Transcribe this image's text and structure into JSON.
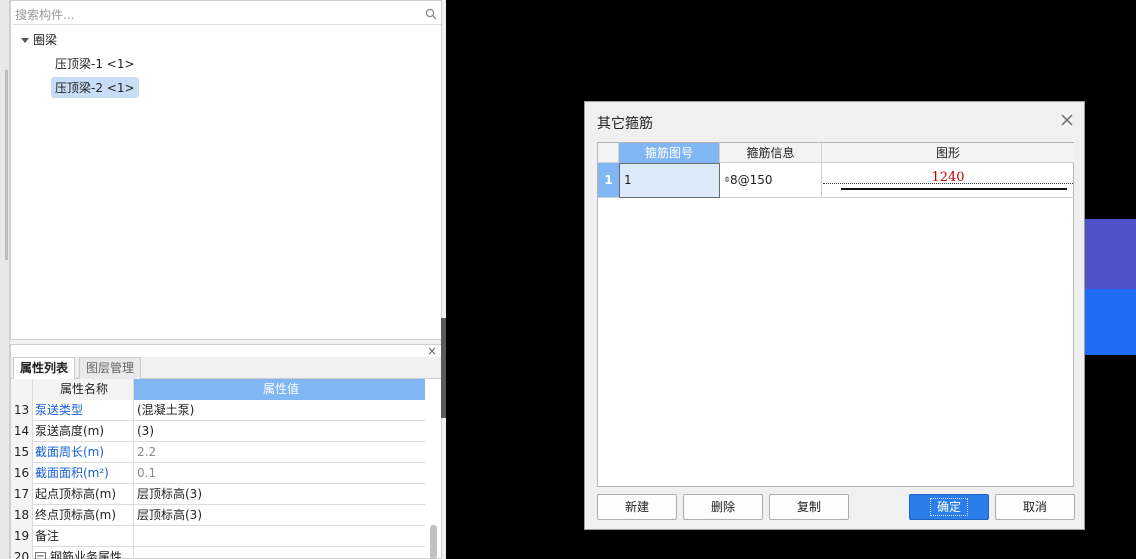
{
  "left_panel": {
    "search": {
      "placeholder": "搜索构件..."
    },
    "tree": {
      "root": "圈梁",
      "children": [
        "压顶梁-1 <1>",
        "压顶梁-2 <1>"
      ],
      "selected_index": 1
    }
  },
  "properties": {
    "close_glyph": "×",
    "tabs": [
      "属性列表",
      "图层管理"
    ],
    "header": {
      "name": "属性名称",
      "value": "属性值"
    },
    "rows": [
      {
        "num": "13",
        "name": "泵送类型",
        "value": "(混凝土泵)"
      },
      {
        "num": "14",
        "name": "泵送高度(m)",
        "value": "(3)"
      },
      {
        "num": "15",
        "name": "截面周长(m)",
        "value": "2.2"
      },
      {
        "num": "16",
        "name": "截面面积(m²)",
        "value": "0.1"
      },
      {
        "num": "17",
        "name": "起点顶标高(m)",
        "value": "层顶标高(3)"
      },
      {
        "num": "18",
        "name": "终点顶标高(m)",
        "value": "层顶标高(3)"
      },
      {
        "num": "19",
        "name": "备注",
        "value": ""
      },
      {
        "num": "20",
        "name": "钢筋业务属性",
        "value": ""
      }
    ]
  },
  "dialog": {
    "title": "其它箍筋",
    "grid": {
      "headers": [
        "箍筋图号",
        "箍筋信息",
        "图形"
      ],
      "rows": [
        {
          "row_num": "1",
          "shape_no": "1",
          "rebar_glyph": "⌽",
          "rebar_info": "8@150",
          "shape_value": "1240"
        }
      ]
    },
    "buttons": {
      "new": "新建",
      "delete": "删除",
      "copy": "复制",
      "ok": "确定",
      "cancel": "取消"
    }
  },
  "colors": {
    "accent_blue": "#7fb6f3",
    "ok_button": "#2b7de9",
    "shape_text": "#c00000",
    "block_purple": "#4f52c7",
    "block_blue": "#1f6bf5"
  }
}
